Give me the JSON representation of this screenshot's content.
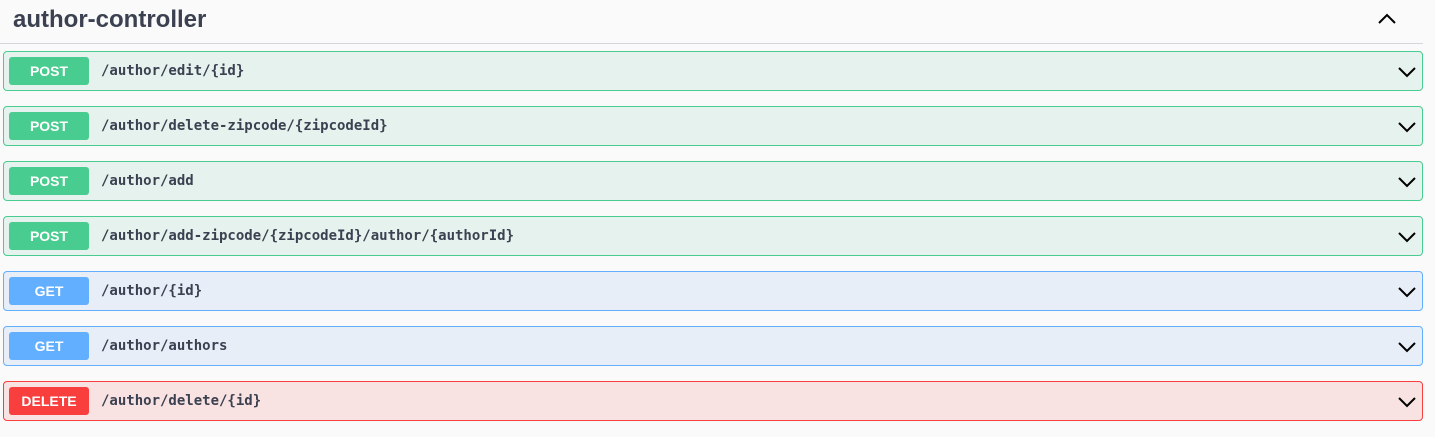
{
  "section": {
    "title": "author-controller",
    "collapse_icon": "chevron-up-icon"
  },
  "operations": [
    {
      "method": "POST",
      "path": "/author/edit/{id}"
    },
    {
      "method": "POST",
      "path": "/author/delete-zipcode/{zipcodeId}"
    },
    {
      "method": "POST",
      "path": "/author/add"
    },
    {
      "method": "POST",
      "path": "/author/add-zipcode/{zipcodeId}/author/{authorId}"
    },
    {
      "method": "GET",
      "path": "/author/{id}"
    },
    {
      "method": "GET",
      "path": "/author/authors"
    },
    {
      "method": "DELETE",
      "path": "/author/delete/{id}"
    }
  ],
  "colors": {
    "post": "#49cc90",
    "get": "#61affe",
    "delete": "#f93e3e",
    "text": "#3b4151"
  },
  "expand_icon": "chevron-down-icon"
}
